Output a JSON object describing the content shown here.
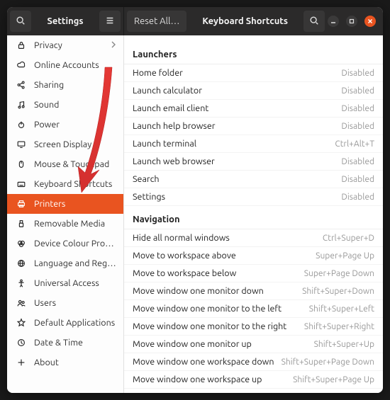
{
  "header": {
    "app_title": "Settings",
    "panel_title": "Keyboard Shortcuts",
    "reset_label": "Reset All…"
  },
  "colors": {
    "accent": "#e95420",
    "headerbar": "#2b2a2a"
  },
  "sidebar": {
    "active_index": 8,
    "items": [
      {
        "icon": "lock",
        "label": "Privacy",
        "chevron": true
      },
      {
        "icon": "cloud",
        "label": "Online Accounts"
      },
      {
        "icon": "share",
        "label": "Sharing"
      },
      {
        "icon": "music",
        "label": "Sound"
      },
      {
        "icon": "power",
        "label": "Power"
      },
      {
        "icon": "display",
        "label": "Screen Display"
      },
      {
        "icon": "mouse",
        "label": "Mouse & Touchpad"
      },
      {
        "icon": "keyboard",
        "label": "Keyboard Shortcuts"
      },
      {
        "icon": "printer",
        "label": "Printers"
      },
      {
        "icon": "usb",
        "label": "Removable Media"
      },
      {
        "icon": "color",
        "label": "Device Colour Profiles"
      },
      {
        "icon": "globe",
        "label": "Language and Region"
      },
      {
        "icon": "universal",
        "label": "Universal Access"
      },
      {
        "icon": "users",
        "label": "Users"
      },
      {
        "icon": "star",
        "label": "Default Applications"
      },
      {
        "icon": "clock",
        "label": "Date & Time"
      },
      {
        "icon": "plus",
        "label": "About"
      }
    ]
  },
  "shortcuts": {
    "sections": [
      {
        "title": "Launchers",
        "rows": [
          {
            "action": "Home folder",
            "binding": "Disabled"
          },
          {
            "action": "Launch calculator",
            "binding": "Disabled"
          },
          {
            "action": "Launch email client",
            "binding": "Disabled"
          },
          {
            "action": "Launch help browser",
            "binding": "Disabled"
          },
          {
            "action": "Launch terminal",
            "binding": "Ctrl+Alt+T"
          },
          {
            "action": "Launch web browser",
            "binding": "Disabled"
          },
          {
            "action": "Search",
            "binding": "Disabled"
          },
          {
            "action": "Settings",
            "binding": "Disabled"
          }
        ]
      },
      {
        "title": "Navigation",
        "rows": [
          {
            "action": "Hide all normal windows",
            "binding": "Ctrl+Super+D"
          },
          {
            "action": "Move to workspace above",
            "binding": "Super+Page Up"
          },
          {
            "action": "Move to workspace below",
            "binding": "Super+Page Down"
          },
          {
            "action": "Move window one monitor down",
            "binding": "Shift+Super+Down"
          },
          {
            "action": "Move window one monitor to the left",
            "binding": "Shift+Super+Left"
          },
          {
            "action": "Move window one monitor to the right",
            "binding": "Shift+Super+Right"
          },
          {
            "action": "Move window one monitor up",
            "binding": "Shift+Super+Up"
          },
          {
            "action": "Move window one workspace down",
            "binding": "Shift+Super+Page Down"
          },
          {
            "action": "Move window one workspace up",
            "binding": "Shift+Super+Page Up"
          }
        ]
      }
    ]
  }
}
